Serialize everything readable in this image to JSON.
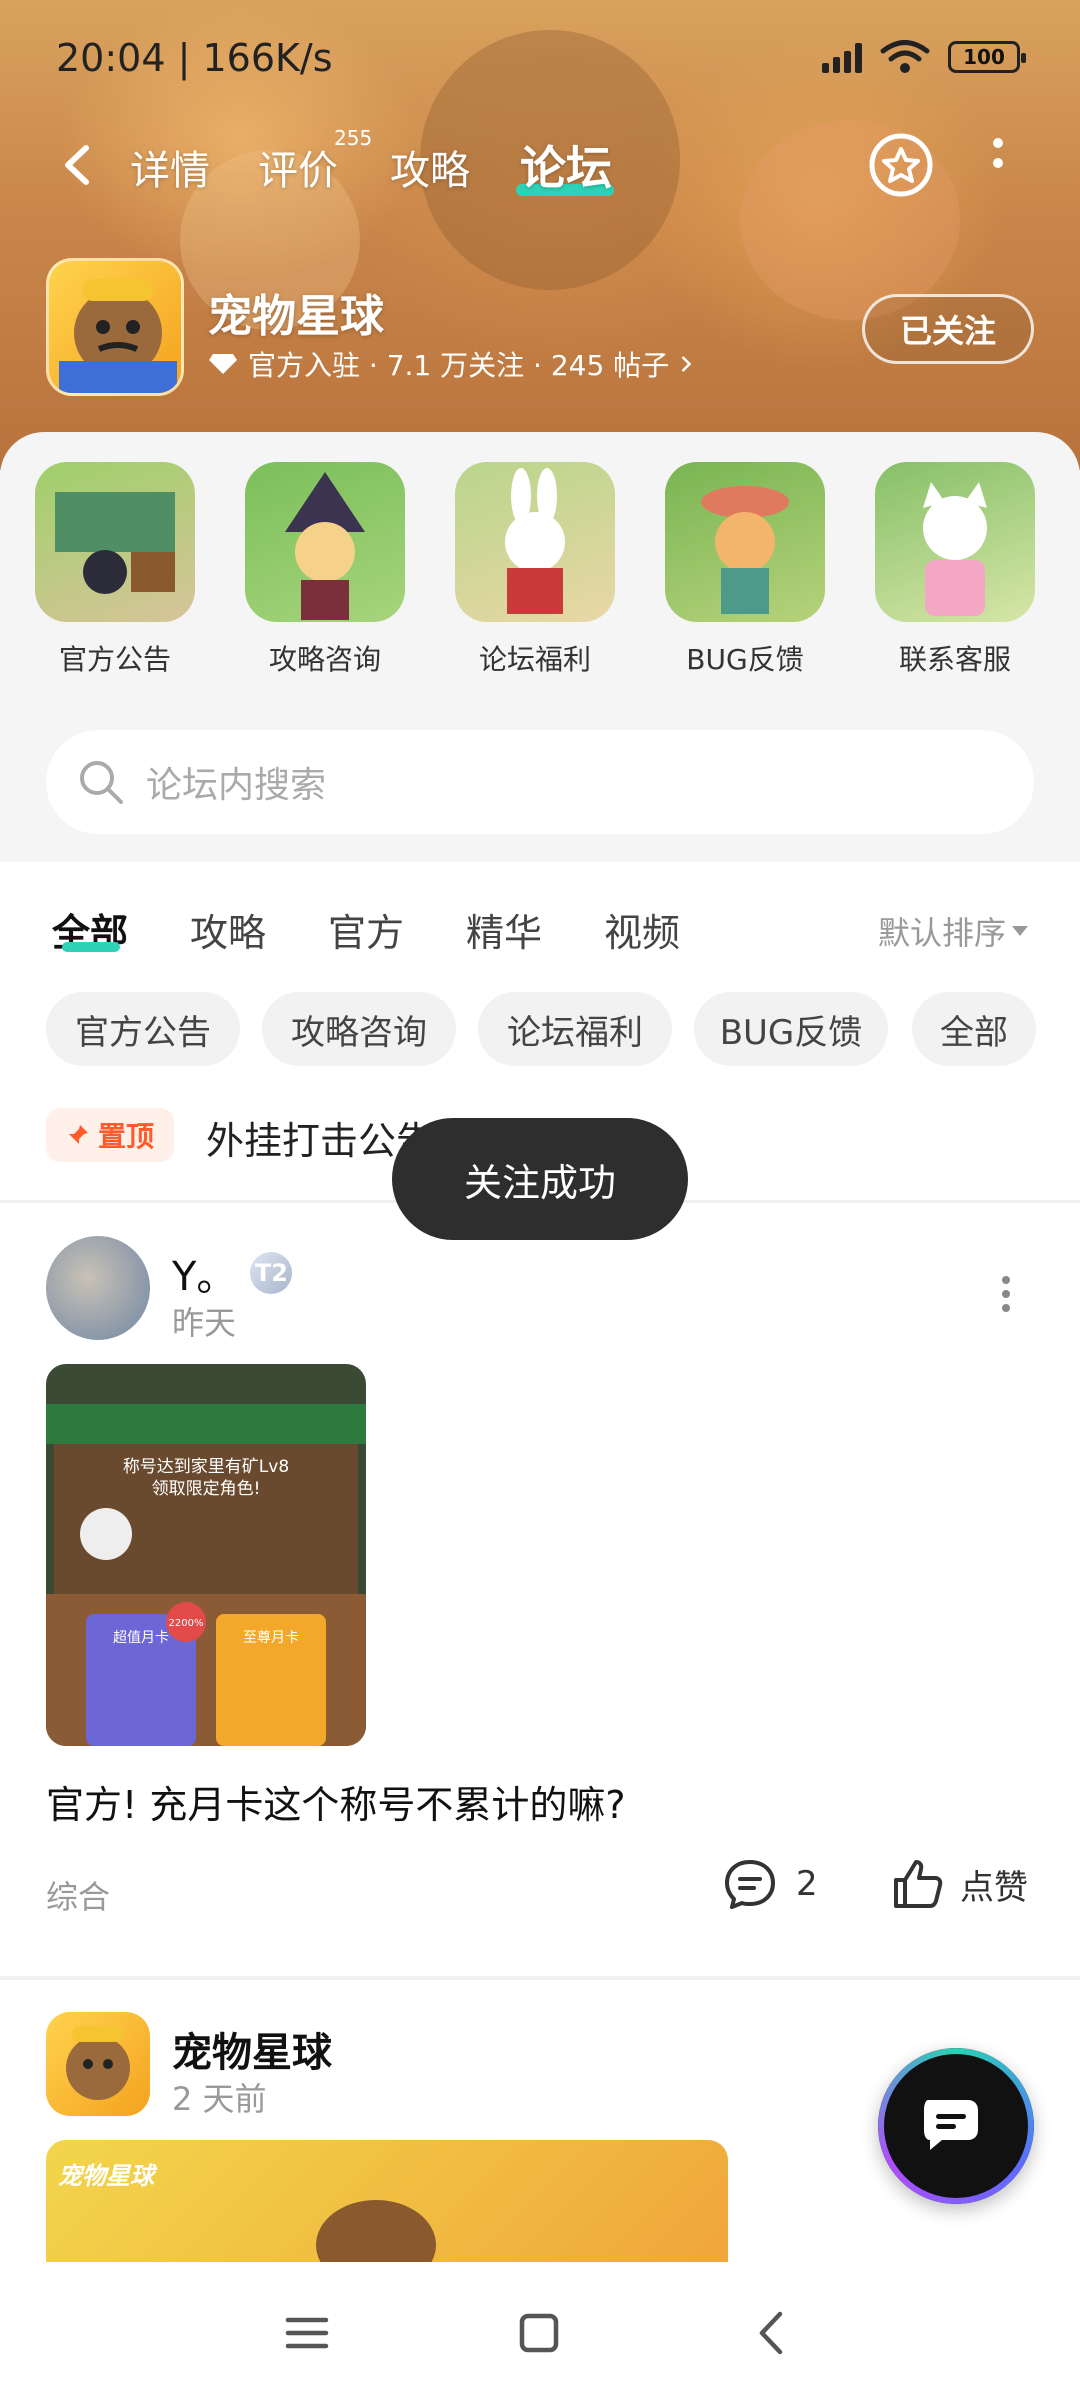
{
  "status": {
    "time": "20:04 | 166K/s",
    "battery": "100"
  },
  "nav": {
    "tabs": [
      {
        "label": "详情"
      },
      {
        "label": "评价",
        "badge": "255"
      },
      {
        "label": "攻略"
      },
      {
        "label": "论坛",
        "active": true
      }
    ]
  },
  "game": {
    "name": "宠物星球",
    "meta": "官方入驻 · 7.1 万关注 · 245 帖子",
    "follow_label": "已关注"
  },
  "quick_links": [
    {
      "label": "官方公告"
    },
    {
      "label": "攻略咨询"
    },
    {
      "label": "论坛福利"
    },
    {
      "label": "BUG反馈"
    },
    {
      "label": "联系客服"
    }
  ],
  "search": {
    "placeholder": "论坛内搜索"
  },
  "filter_tabs": [
    {
      "label": "全部",
      "active": true
    },
    {
      "label": "攻略"
    },
    {
      "label": "官方"
    },
    {
      "label": "精华"
    },
    {
      "label": "视频"
    }
  ],
  "sort_label": "默认排序",
  "chips": [
    {
      "label": "官方公告"
    },
    {
      "label": "攻略咨询"
    },
    {
      "label": "论坛福利"
    },
    {
      "label": "BUG反馈"
    },
    {
      "label": "全部"
    }
  ],
  "pinned": {
    "badge": "置顶",
    "text": "外挂打击公告"
  },
  "toast": "关注成功",
  "posts": [
    {
      "author": "Y。",
      "level": "T2",
      "time": "昨天",
      "image_text": {
        "line1": "称号达到家里有矿Lv8",
        "line2": "领取限定角色!",
        "card1": "超值月卡",
        "card2": "至尊月卡",
        "price": "2200%"
      },
      "title": "官方! 充月卡这个称号不累计的嘛?",
      "category": "综合",
      "comments": "2",
      "like_label": "点赞"
    },
    {
      "author": "宠物星球",
      "time": "2 天前",
      "banner_logo": "宠物星球"
    }
  ],
  "colors": {
    "accent": "#2ed3b7",
    "pin": "#ff5a2a"
  }
}
